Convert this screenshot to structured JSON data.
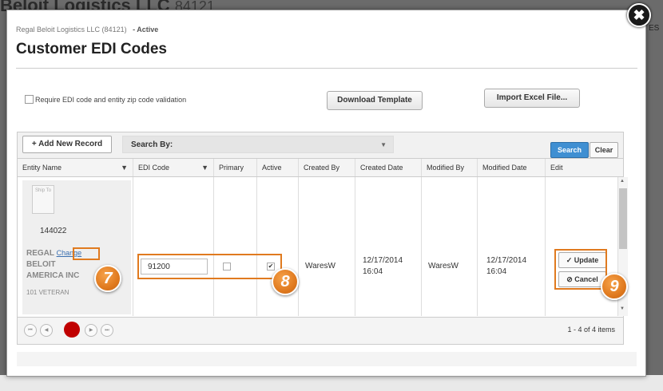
{
  "background": {
    "title": "Beloit Logistics LLC",
    "title_num": "84121",
    "es": "ES",
    "footer": ""
  },
  "modal": {
    "subtitle_company": "Regal Beloit Logistics LLC (84121)",
    "subtitle_status": "- Active",
    "title": "Customer EDI Codes",
    "close": "✖"
  },
  "options": {
    "require_label": "Require EDI code and entity zip code validation",
    "download_template": "Download Template",
    "import_excel": "Import Excel File..."
  },
  "toolbar": {
    "add_new": "+ Add New Record",
    "search_by": "Search By:",
    "search": "Search",
    "clear": "Clear"
  },
  "columns": [
    "Entity Name",
    "EDI Code",
    "Primary",
    "Active",
    "Created By",
    "Created Date",
    "Modified By",
    "Modified Date",
    "Edit"
  ],
  "row": {
    "ship_to": "Ship To",
    "entity_number": "144022",
    "entity_name_1": "REGAL",
    "change": "Change",
    "entity_name_2": "BELOIT",
    "entity_name_3": "AMERICA INC",
    "entity_address": "101 VETERAN",
    "edi_code": "91200",
    "primary_checked": false,
    "active_checked": true,
    "created_by": "WaresW",
    "created_date": "12/17/2014",
    "created_time": "16:04",
    "modified_by": "WaresW",
    "modified_date": "12/17/2014",
    "modified_time": "16:04",
    "update": "Update",
    "cancel": "Cancel"
  },
  "pager": {
    "info": "1 - 4 of 4 items"
  },
  "callouts": [
    "7",
    "8",
    "9"
  ],
  "colors": {
    "accent": "#e07a1f",
    "search_blue": "#3f8fd2",
    "current_page": "#c00000"
  }
}
